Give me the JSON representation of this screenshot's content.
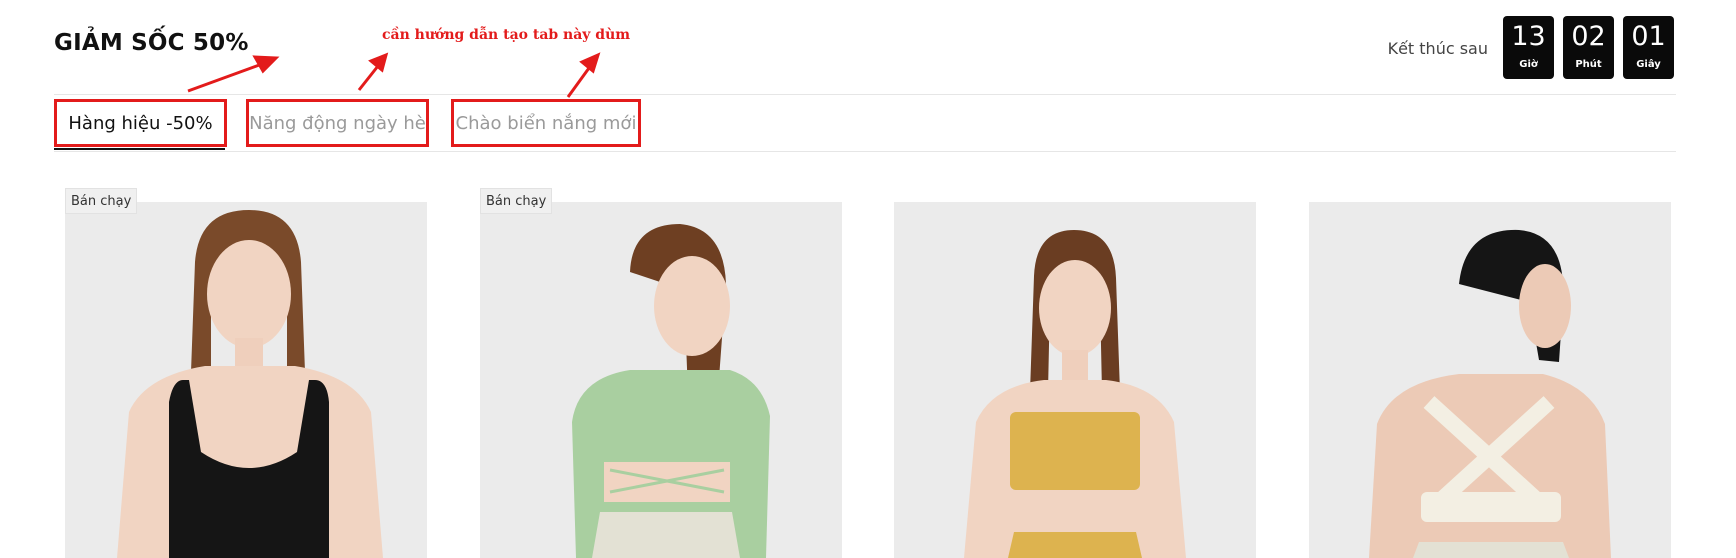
{
  "section": {
    "title": "GIẢM SỐC 50%"
  },
  "countdown": {
    "label": "Kết thúc sau",
    "units": [
      {
        "value": "13",
        "unit": "Giờ"
      },
      {
        "value": "02",
        "unit": "Phút"
      },
      {
        "value": "01",
        "unit": "Giây"
      }
    ]
  },
  "tabs": [
    {
      "label": "Hàng hiệu -50%",
      "active": true
    },
    {
      "label": "Năng động ngày hè",
      "active": false
    },
    {
      "label": "Chào biển nắng mới",
      "active": false
    }
  ],
  "annotation": {
    "text": "cần hướng dẫn tạo tab này dùm",
    "color": "#e31b1b"
  },
  "products": [
    {
      "badge": "Bán chạy",
      "top_color": "#151515",
      "hair": "#7a4a2a"
    },
    {
      "badge": "Bán chạy",
      "top_color": "#a9cfa0",
      "hair": "#6e3f22"
    },
    {
      "badge": "",
      "top_color": "#ddb34f",
      "hair": "#6a3d22"
    },
    {
      "badge": "",
      "top_color": "#f3efe3",
      "hair": "#151515"
    }
  ]
}
